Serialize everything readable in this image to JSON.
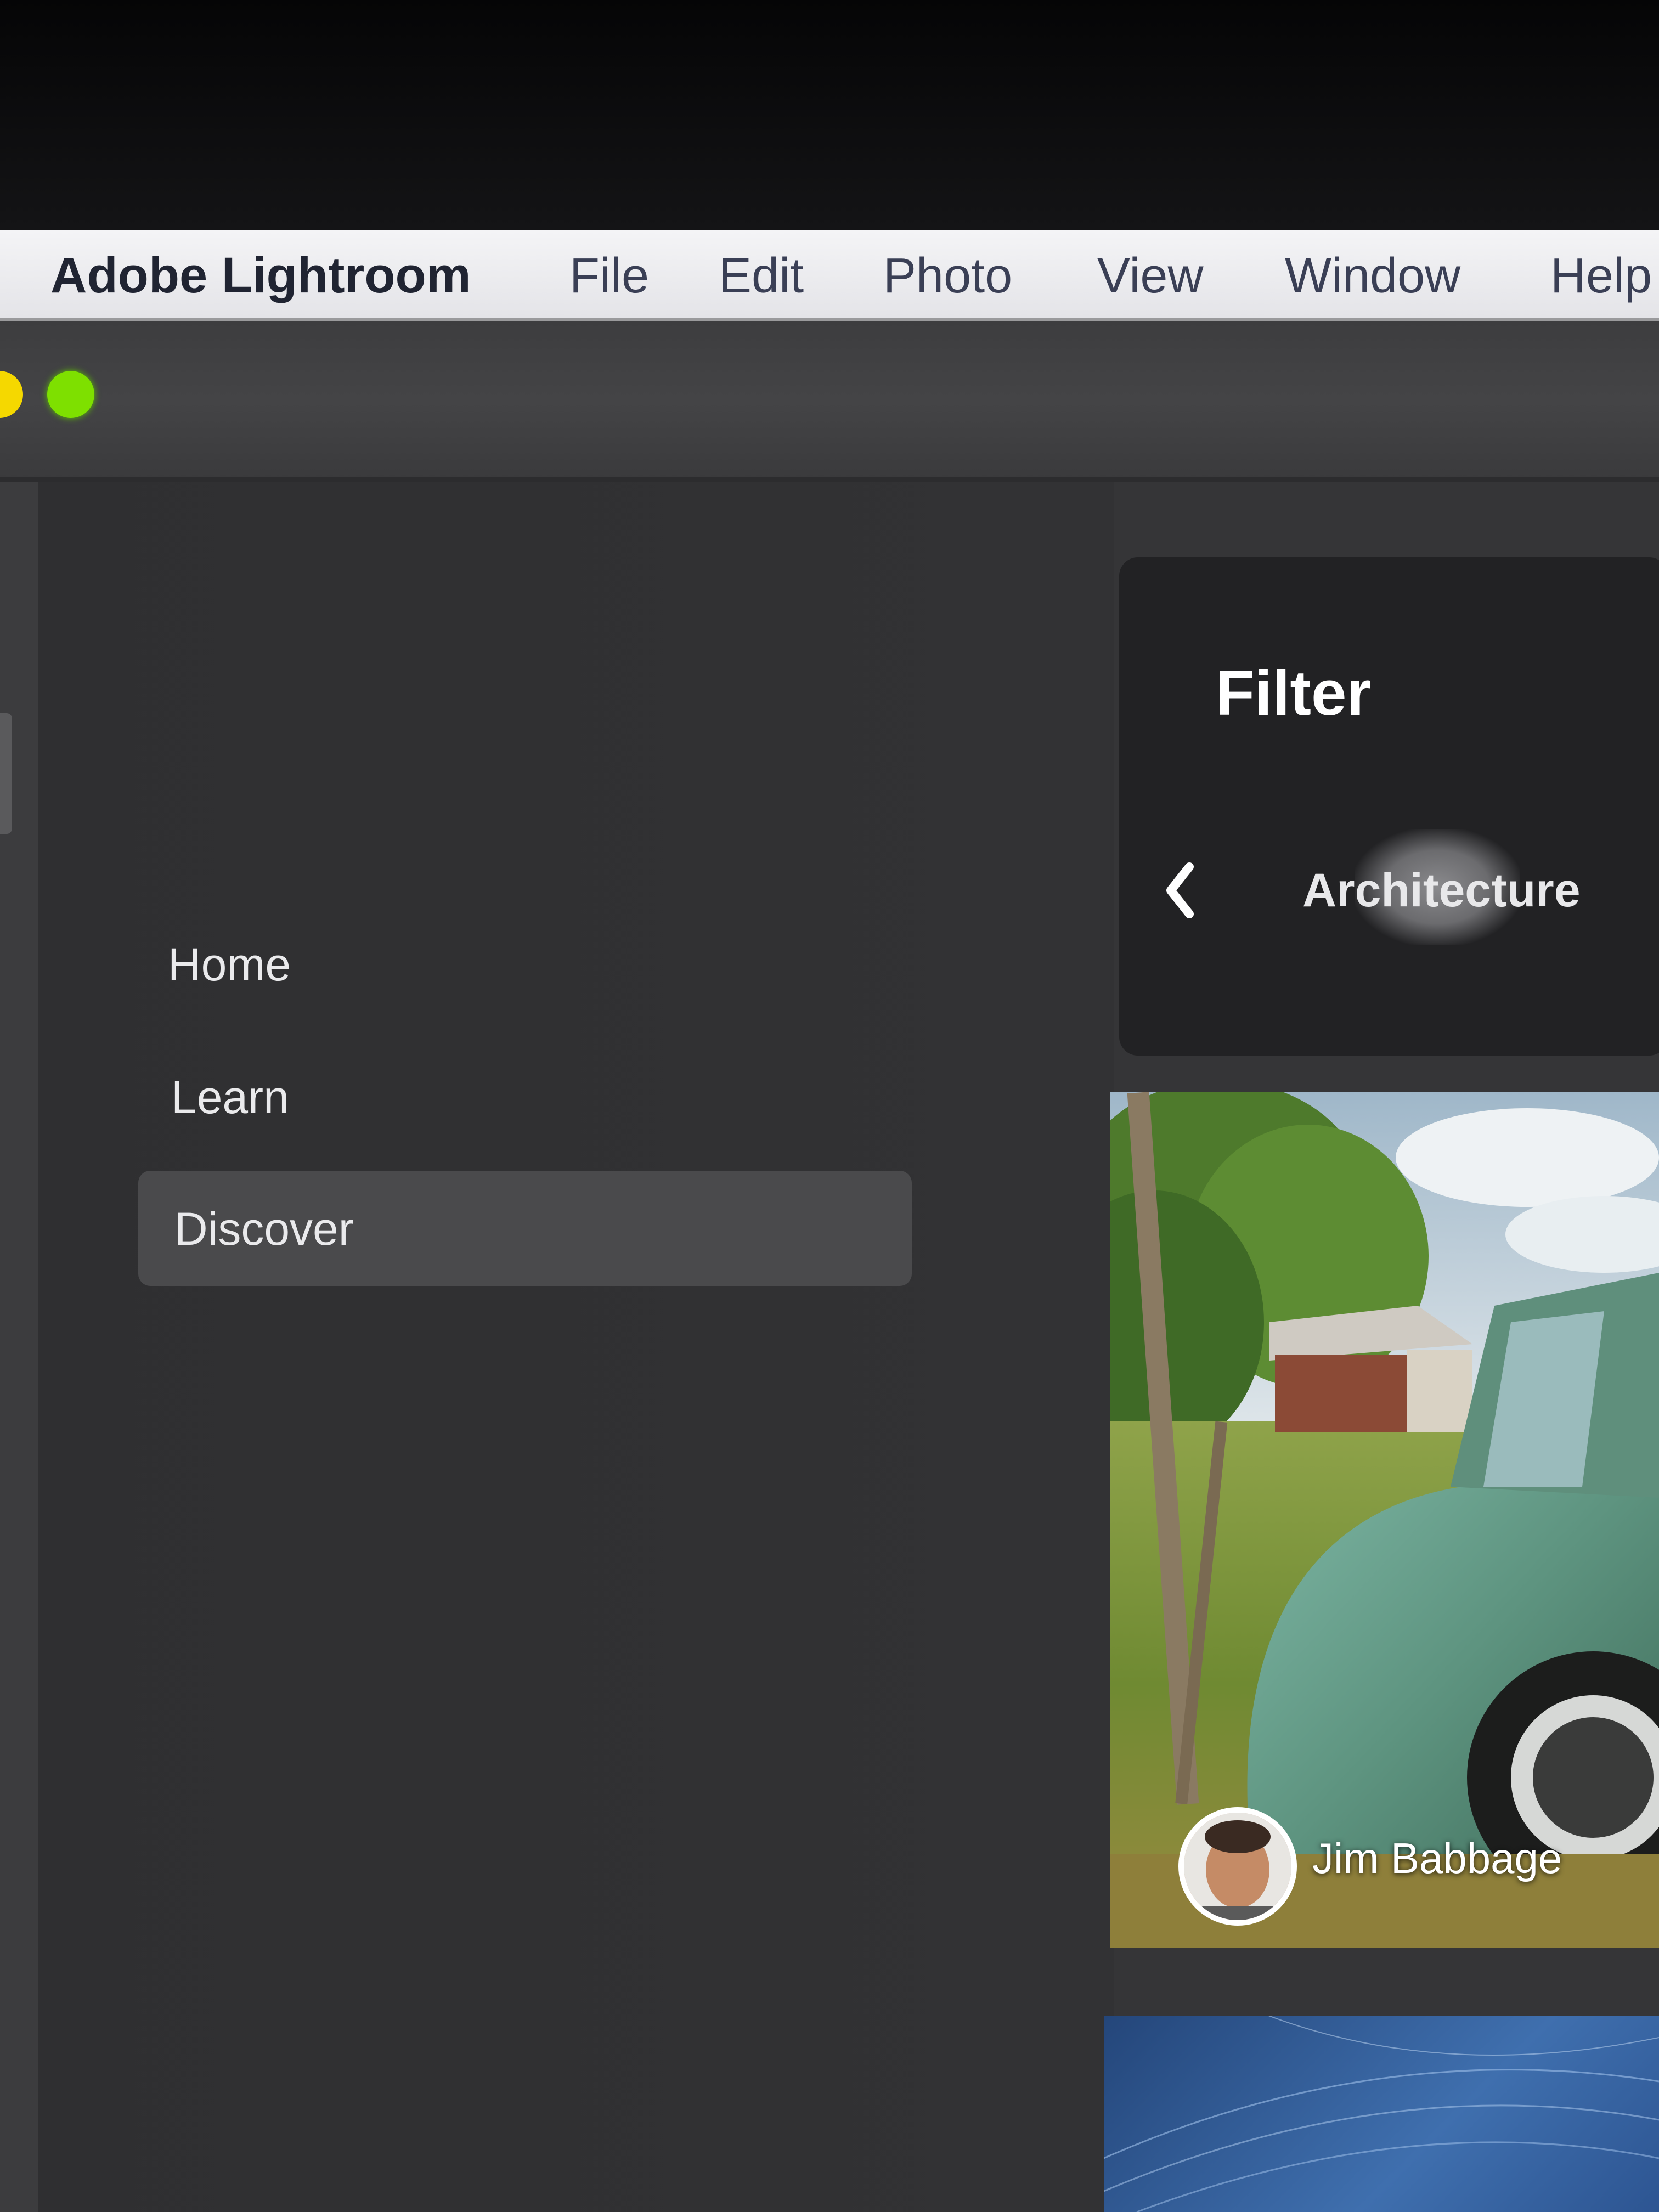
{
  "menubar": {
    "app_name": "Adobe Lightroom",
    "items": [
      "File",
      "Edit",
      "Photo",
      "View",
      "Window",
      "Help"
    ]
  },
  "window": {
    "controls": [
      "minimize-button",
      "zoom-button"
    ]
  },
  "sidebar": {
    "items": [
      {
        "label": "Home",
        "selected": false
      },
      {
        "label": "Learn",
        "selected": false
      },
      {
        "label": "Discover",
        "selected": true
      }
    ]
  },
  "filter": {
    "title": "Filter",
    "value": "Architecture",
    "back_icon": "chevron-left-icon"
  },
  "feed": {
    "cards": [
      {
        "author": "Jim Babbage"
      }
    ]
  },
  "colors": {
    "sidebar_bg": "#323234",
    "selected_bg": "#4a4a4c",
    "panel_bg": "#222224",
    "traffic_yellow": "#f5d800",
    "traffic_green": "#7ee000"
  }
}
